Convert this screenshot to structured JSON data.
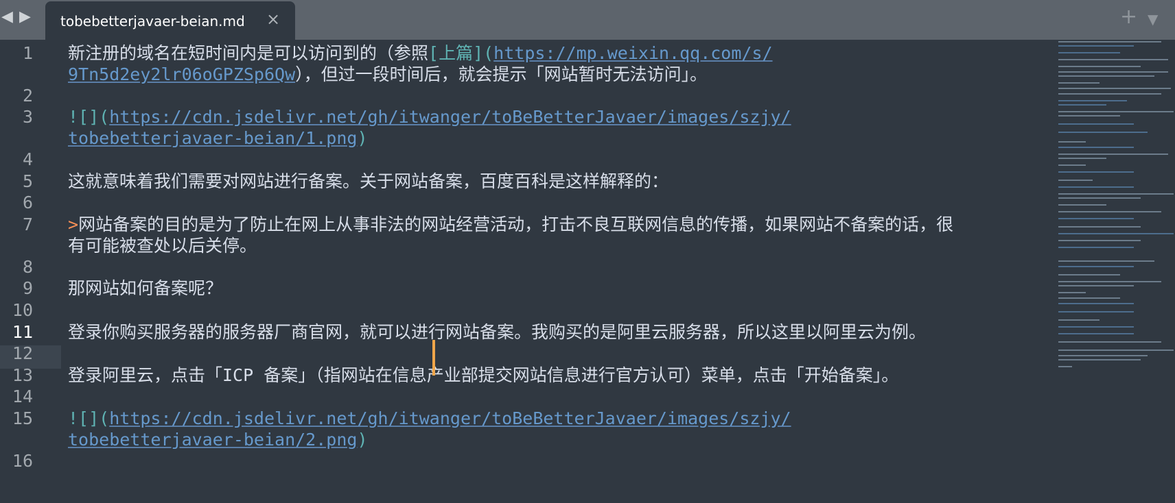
{
  "tabbar": {
    "back_icon": "◀",
    "forward_icon": "▶",
    "tab_title": "tobebetterjavaer-beian.md",
    "close_icon": "×",
    "new_tab_icon": "+",
    "menu_icon": "▼"
  },
  "editor": {
    "active_line": "11",
    "lines": [
      {
        "no": "1",
        "a": "新注册的域名在短时间内是可以访问到的（参照",
        "b": "[上篇](",
        "c": "https://mp.weixin.qq.com/s/",
        "d": ""
      },
      {
        "no": "",
        "a": "",
        "b": "",
        "c": "9Tn5d2ey2lr06oGPZSp6Qw",
        "d": "），但过一段时间后，就会提示「网站暂时无法访问」。"
      },
      {
        "no": "2"
      },
      {
        "no": "3",
        "b": "![](",
        "c": "https://cdn.jsdelivr.net/gh/itwanger/toBeBetterJavaer/images/szjy/"
      },
      {
        "no": "",
        "c": "tobebetterjavaer-beian/1.png",
        "d": ")"
      },
      {
        "no": "4"
      },
      {
        "no": "5",
        "a": "这就意味着我们需要对网站进行备案。关于网站备案，百度百科是这样解释的："
      },
      {
        "no": "6"
      },
      {
        "no": "7",
        "q": ">",
        "a": "网站备案的目的是为了防止在网上从事非法的网站经营活动，打击不良互联网信息的传播，如果网站不备案的话，很"
      },
      {
        "no": "",
        "a": "有可能被查处以后关停。"
      },
      {
        "no": "8"
      },
      {
        "no": "9",
        "a": "那网站如何备案呢？"
      },
      {
        "no": "10"
      },
      {
        "no": "11",
        "a": "登录你购买服务器的服务器厂商官网，就可以进行网站备案。我购买的是阿里云服务器，所以这里以阿里云为例。"
      },
      {
        "no": "12"
      },
      {
        "no": "13",
        "a": "登录阿里云，点击「ICP 备案」（指网站在信息产业部提交网站信息进行官方认可）菜单，点击「开始备案」。"
      },
      {
        "no": "14"
      },
      {
        "no": "15",
        "b": "![](",
        "c": "https://cdn.jsdelivr.net/gh/itwanger/toBeBetterJavaer/images/szjy/"
      },
      {
        "no": "",
        "c": "tobebetterjavaer-beian/2.png",
        "d": ")"
      },
      {
        "no": "16"
      }
    ]
  },
  "colors": {
    "background": "#303841",
    "tabbar": "#5d646c",
    "link": "#6699cc",
    "teal": "#5fb3b3",
    "caret": "#f0a64a",
    "quote": "#f99157"
  }
}
